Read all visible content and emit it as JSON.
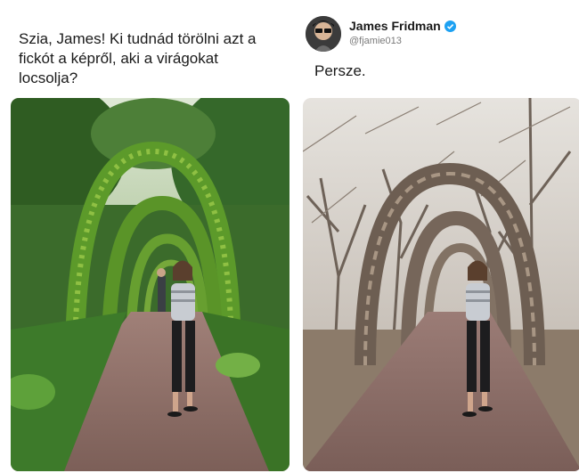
{
  "request_post": {
    "text": "Szia, James! Ki tudnád törölni azt a fickót a képről, aki a virágokat locsolja?"
  },
  "reply_post": {
    "author_name": "James Fridman",
    "handle": "@fjamie013",
    "verified": true,
    "text": "Persze."
  },
  "colors": {
    "verified_badge": "#1da1f2",
    "path": "#8a6a62",
    "foliage": "#3f7a2c",
    "bare_branches": "#7a6e64"
  },
  "icons": {
    "verified": "verified-check-icon",
    "avatar": "avatar"
  }
}
